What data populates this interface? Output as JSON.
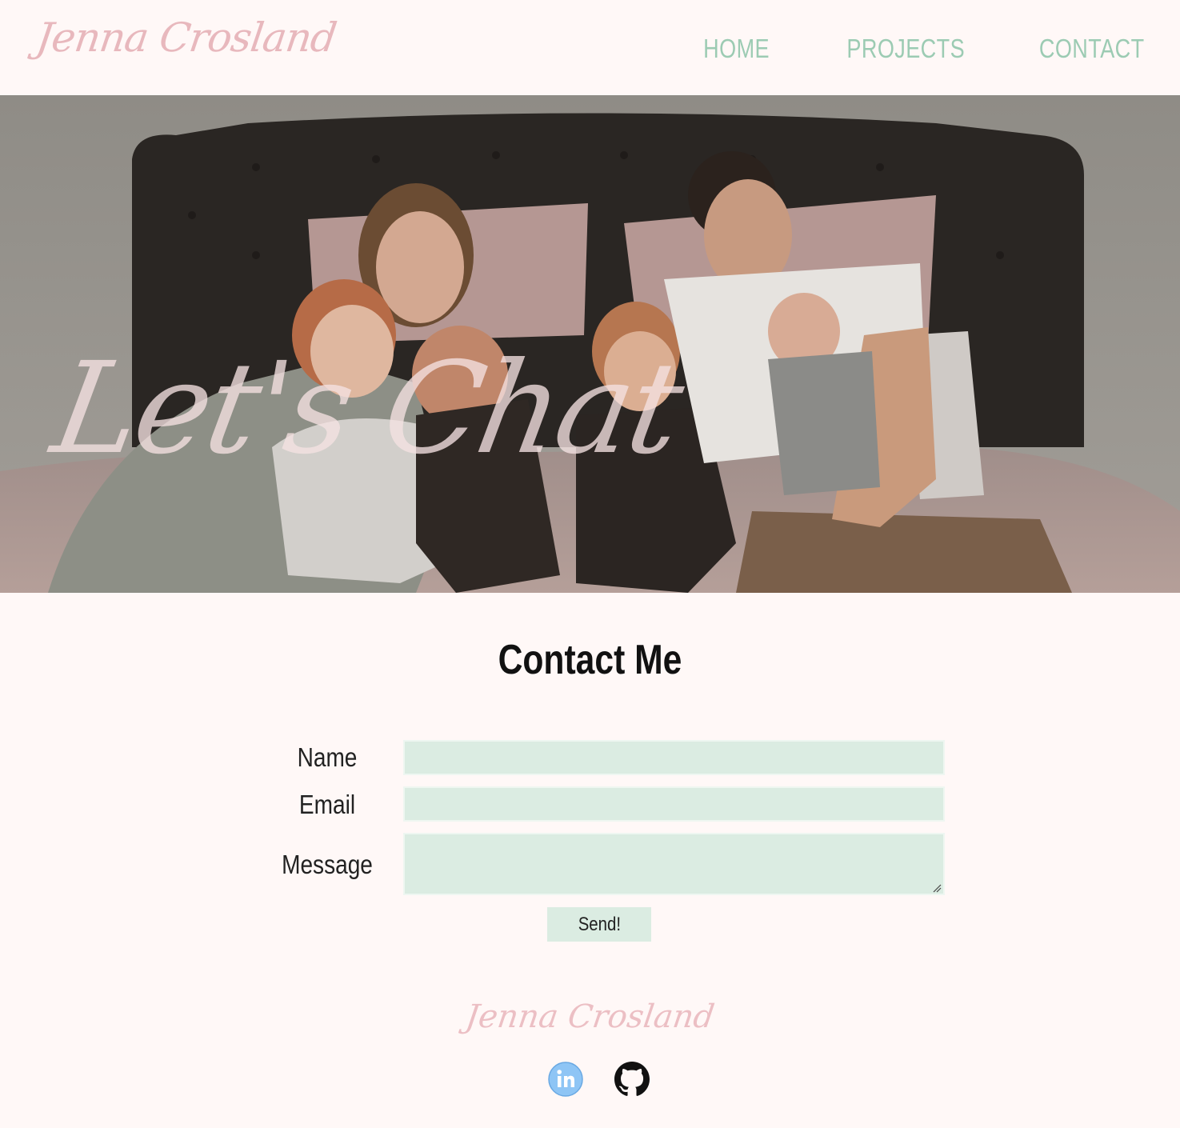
{
  "brand": {
    "name": "Jenna Crosland"
  },
  "nav": {
    "items": [
      {
        "label": "HOME"
      },
      {
        "label": "PROJECTS"
      },
      {
        "label": "CONTACT"
      }
    ]
  },
  "hero": {
    "title": "Let's Chat"
  },
  "contact": {
    "title": "Contact Me",
    "name_label": "Name",
    "name_value": "",
    "email_label": "Email",
    "email_value": "",
    "message_label": "Message",
    "message_value": "",
    "send_label": "Send!"
  },
  "footer": {
    "name": "Jenna Crosland",
    "social": [
      {
        "icon": "linkedin-icon"
      },
      {
        "icon": "github-icon"
      }
    ]
  },
  "colors": {
    "background": "#fff8f7",
    "brand_pink": "#e8b8bd",
    "nav_green": "#9ccbb3",
    "field_green": "#dbece2",
    "linkedin_blue": "#8ec5f5"
  }
}
